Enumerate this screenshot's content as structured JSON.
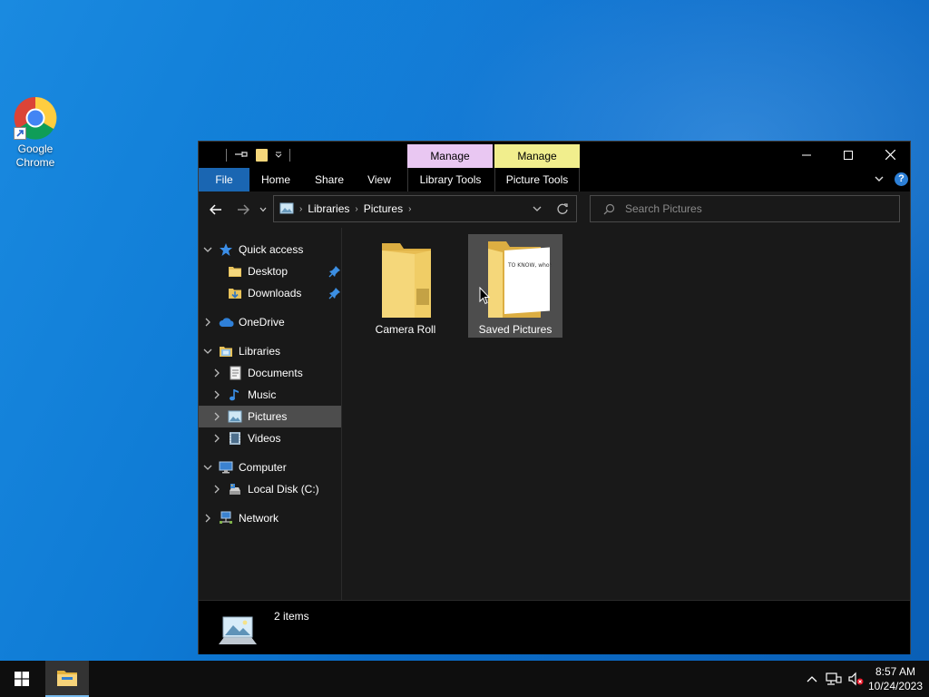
{
  "desktop": {
    "icons": [
      {
        "label_line1": "Google",
        "label_line2": "Chrome",
        "icon": "chrome-icon"
      }
    ]
  },
  "window": {
    "context_tabs": [
      {
        "label": "Manage",
        "color": "#e9c7f2"
      },
      {
        "label": "Manage",
        "color": "#f1ee8d"
      }
    ],
    "ribbon_tabs": {
      "file": "File",
      "home": "Home",
      "share": "Share",
      "view": "View",
      "library_tools": "Library Tools",
      "picture_tools": "Picture Tools"
    },
    "help_label": "?",
    "address": {
      "crumbs": [
        "Libraries",
        "Pictures"
      ]
    },
    "search": {
      "placeholder": "Search Pictures"
    },
    "nav_tree": [
      {
        "label": "Quick access",
        "icon": "star-icon"
      },
      {
        "label": "Desktop",
        "icon": "folder-icon",
        "pinned": true
      },
      {
        "label": "Downloads",
        "icon": "download-folder-icon",
        "pinned": true
      },
      {
        "label": "OneDrive",
        "icon": "cloud-icon"
      },
      {
        "label": "Libraries",
        "icon": "libraries-icon"
      },
      {
        "label": "Documents",
        "icon": "documents-icon"
      },
      {
        "label": "Music",
        "icon": "music-icon"
      },
      {
        "label": "Pictures",
        "icon": "pictures-icon",
        "selected": true
      },
      {
        "label": "Videos",
        "icon": "videos-icon"
      },
      {
        "label": "Computer",
        "icon": "computer-icon"
      },
      {
        "label": "Local Disk (C:)",
        "icon": "drive-icon"
      },
      {
        "label": "Network",
        "icon": "network-icon"
      }
    ],
    "items": [
      {
        "name": "Camera Roll",
        "type": "folder"
      },
      {
        "name": "Saved Pictures",
        "type": "folder",
        "preview_text": "TO KNOW ... US"
      }
    ],
    "status": {
      "count_text": "2 items"
    }
  },
  "taskbar": {
    "time": "8:57 AM",
    "date": "10/24/2023",
    "accent": "#76b9ed"
  }
}
